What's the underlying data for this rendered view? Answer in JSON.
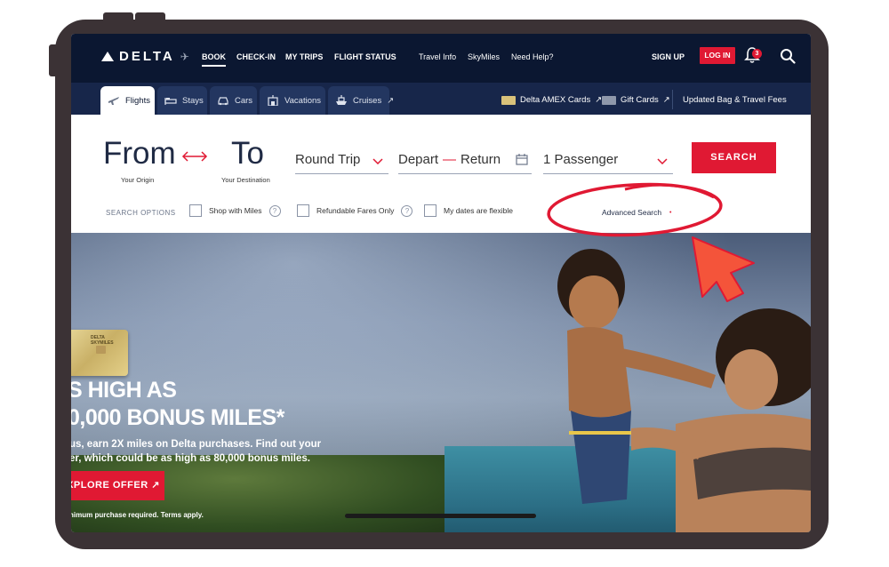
{
  "brand": {
    "name": "DELTA",
    "accent": "#e01933",
    "navy": "#0b1731"
  },
  "topnav": {
    "links": [
      {
        "label": "BOOK",
        "active": true
      },
      {
        "label": "CHECK-IN"
      },
      {
        "label": "MY TRIPS"
      },
      {
        "label": "FLIGHT STATUS"
      },
      {
        "label": "Travel Info"
      },
      {
        "label": "SkyMiles"
      },
      {
        "label": "Need Help?"
      }
    ],
    "sign_up": "SIGN UP",
    "log_in": "LOG IN",
    "notification_count": "3",
    "icons": {
      "bell": "bell-icon",
      "search": "search-icon"
    }
  },
  "subnav": {
    "tabs": [
      {
        "label": "Flights",
        "icon": "plane-icon",
        "active": true
      },
      {
        "label": "Stays",
        "icon": "bed-icon"
      },
      {
        "label": "Cars",
        "icon": "car-icon"
      },
      {
        "label": "Vacations",
        "icon": "hotel-icon"
      },
      {
        "label": "Cruises",
        "icon": "ship-icon",
        "external": "↗"
      }
    ],
    "links": [
      {
        "label": "Delta AMEX Cards",
        "external": "↗"
      },
      {
        "label": "Gift Cards",
        "external": "↗"
      },
      {
        "label": "Updated Bag & Travel Fees"
      }
    ]
  },
  "booking": {
    "from_label": "From",
    "from_caption": "Your Origin",
    "to_label": "To",
    "to_caption": "Your Destination",
    "trip_type": "Round Trip",
    "depart": "Depart",
    "dash": "—",
    "return": "Return",
    "passengers": "1 Passenger",
    "search_button": "SEARCH",
    "search_options_label": "SEARCH OPTIONS",
    "options": [
      {
        "label": "Shop with Miles",
        "help": "?"
      },
      {
        "label": "Refundable Fares Only",
        "help": "?"
      },
      {
        "label": "My dates are flexible"
      }
    ],
    "advanced_search": "Advanced Search",
    "advanced_marker": "•"
  },
  "hero": {
    "card_brand": "SKYMILES",
    "card_issuer": "DELTA",
    "headline_1": "S HIGH AS",
    "headline_2": "0,000 BONUS MILES*",
    "body_1": "us, earn 2X miles on Delta purchases. Find out your",
    "body_2": "er, which could be as high as 80,000 bonus miles.",
    "cta": "XPLORE OFFER ↗",
    "fineprint": "nimum purchase required. Terms apply."
  }
}
